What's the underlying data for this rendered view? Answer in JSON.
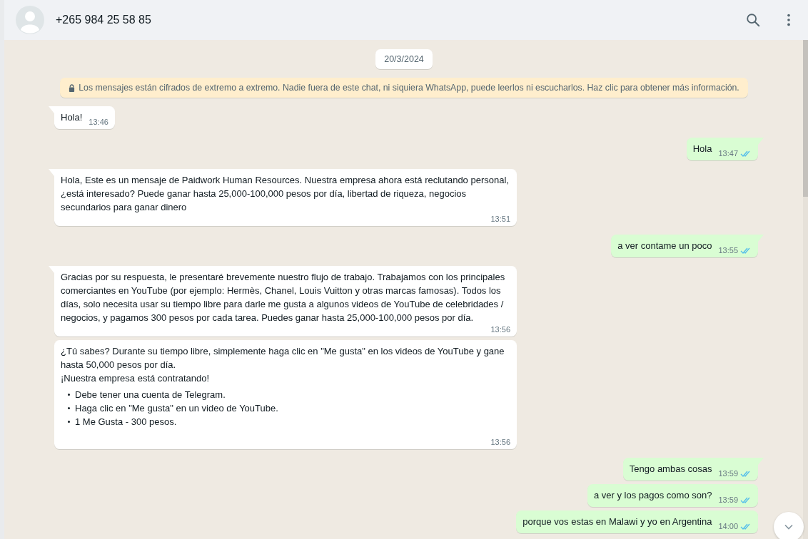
{
  "header": {
    "contact_name": "+265 984 25 58 85"
  },
  "chat": {
    "date_chip": "20/3/2024",
    "encryption_notice": "Los mensajes están cifrados de extremo a extremo. Nadie fuera de este chat, ni siquiera WhatsApp, puede leerlos ni escucharlos. Haz clic para obtener más información.",
    "messages": [
      {
        "outgoing": false,
        "tail": true,
        "paragraphs": [
          "Hola!"
        ],
        "time": "13:46"
      },
      {
        "outgoing": true,
        "tail": true,
        "paragraphs": [
          "Hola"
        ],
        "time": "13:47",
        "read": true
      },
      {
        "outgoing": false,
        "tail": true,
        "paragraphs": [
          "Hola, Este es un mensaje de Paidwork Human Resources. Nuestra empresa ahora está reclutando personal, ¿está interesado? Puede ganar hasta 25,000-100,000 pesos por día, libertad de riqueza, negocios secundarios para ganar dinero"
        ],
        "time": "13:51"
      },
      {
        "outgoing": true,
        "tail": true,
        "paragraphs": [
          "a ver contame un poco"
        ],
        "time": "13:55",
        "read": true
      },
      {
        "outgoing": false,
        "tail": true,
        "paragraphs": [
          "Gracias por su respuesta, le presentaré brevemente nuestro flujo de trabajo. Trabajamos con los principales comerciantes en YouTube (por ejemplo: Hermès, Chanel, Louis Vuitton y otras marcas famosas). Todos los días, solo necesita usar su tiempo libre para darle me gusta a algunos videos de YouTube de celebridades / negocios, y pagamos 300 pesos por cada tarea. Puedes ganar hasta 25,000-100,000 pesos por día."
        ],
        "time": "13:56"
      },
      {
        "outgoing": false,
        "tail": false,
        "paragraphs": [
          "¿Tú sabes? Durante su tiempo libre, simplemente haga clic en \"Me gusta\" en los videos de YouTube y gane hasta 50,000 pesos por día.",
          "¡Nuestra empresa está contratando!"
        ],
        "bullets": [
          "Debe tener una cuenta de Telegram.",
          "Haga clic en \"Me gusta\" en un video de YouTube.",
          "1 Me Gusta - 300 pesos."
        ],
        "time": "13:56"
      },
      {
        "outgoing": true,
        "tail": true,
        "paragraphs": [
          "Tengo ambas cosas"
        ],
        "time": "13:59",
        "read": true
      },
      {
        "outgoing": true,
        "tail": false,
        "paragraphs": [
          "a ver y los pagos como son?"
        ],
        "time": "13:59",
        "read": true
      },
      {
        "outgoing": true,
        "tail": false,
        "paragraphs": [
          "porque vos estas en Malawi y yo en Argentina"
        ],
        "time": "14:00",
        "read": true
      }
    ]
  }
}
